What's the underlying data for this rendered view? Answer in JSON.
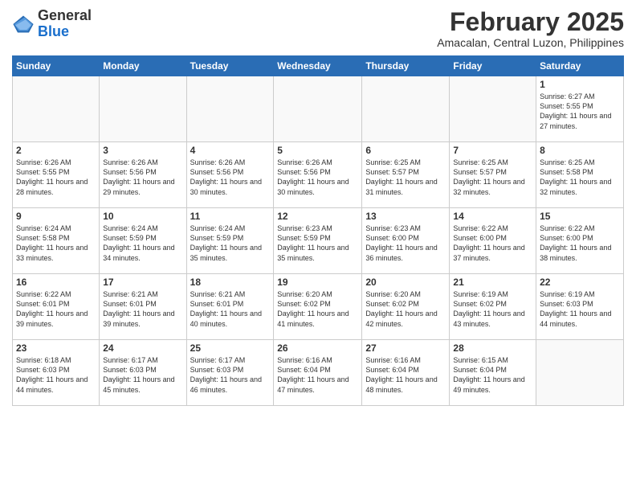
{
  "logo": {
    "general": "General",
    "blue": "Blue"
  },
  "header": {
    "month": "February 2025",
    "location": "Amacalan, Central Luzon, Philippines"
  },
  "weekdays": [
    "Sunday",
    "Monday",
    "Tuesday",
    "Wednesday",
    "Thursday",
    "Friday",
    "Saturday"
  ],
  "weeks": [
    [
      {
        "day": "",
        "info": ""
      },
      {
        "day": "",
        "info": ""
      },
      {
        "day": "",
        "info": ""
      },
      {
        "day": "",
        "info": ""
      },
      {
        "day": "",
        "info": ""
      },
      {
        "day": "",
        "info": ""
      },
      {
        "day": "1",
        "info": "Sunrise: 6:27 AM\nSunset: 5:55 PM\nDaylight: 11 hours and 27 minutes."
      }
    ],
    [
      {
        "day": "2",
        "info": "Sunrise: 6:26 AM\nSunset: 5:55 PM\nDaylight: 11 hours and 28 minutes."
      },
      {
        "day": "3",
        "info": "Sunrise: 6:26 AM\nSunset: 5:56 PM\nDaylight: 11 hours and 29 minutes."
      },
      {
        "day": "4",
        "info": "Sunrise: 6:26 AM\nSunset: 5:56 PM\nDaylight: 11 hours and 30 minutes."
      },
      {
        "day": "5",
        "info": "Sunrise: 6:26 AM\nSunset: 5:56 PM\nDaylight: 11 hours and 30 minutes."
      },
      {
        "day": "6",
        "info": "Sunrise: 6:25 AM\nSunset: 5:57 PM\nDaylight: 11 hours and 31 minutes."
      },
      {
        "day": "7",
        "info": "Sunrise: 6:25 AM\nSunset: 5:57 PM\nDaylight: 11 hours and 32 minutes."
      },
      {
        "day": "8",
        "info": "Sunrise: 6:25 AM\nSunset: 5:58 PM\nDaylight: 11 hours and 32 minutes."
      }
    ],
    [
      {
        "day": "9",
        "info": "Sunrise: 6:24 AM\nSunset: 5:58 PM\nDaylight: 11 hours and 33 minutes."
      },
      {
        "day": "10",
        "info": "Sunrise: 6:24 AM\nSunset: 5:59 PM\nDaylight: 11 hours and 34 minutes."
      },
      {
        "day": "11",
        "info": "Sunrise: 6:24 AM\nSunset: 5:59 PM\nDaylight: 11 hours and 35 minutes."
      },
      {
        "day": "12",
        "info": "Sunrise: 6:23 AM\nSunset: 5:59 PM\nDaylight: 11 hours and 35 minutes."
      },
      {
        "day": "13",
        "info": "Sunrise: 6:23 AM\nSunset: 6:00 PM\nDaylight: 11 hours and 36 minutes."
      },
      {
        "day": "14",
        "info": "Sunrise: 6:22 AM\nSunset: 6:00 PM\nDaylight: 11 hours and 37 minutes."
      },
      {
        "day": "15",
        "info": "Sunrise: 6:22 AM\nSunset: 6:00 PM\nDaylight: 11 hours and 38 minutes."
      }
    ],
    [
      {
        "day": "16",
        "info": "Sunrise: 6:22 AM\nSunset: 6:01 PM\nDaylight: 11 hours and 39 minutes."
      },
      {
        "day": "17",
        "info": "Sunrise: 6:21 AM\nSunset: 6:01 PM\nDaylight: 11 hours and 39 minutes."
      },
      {
        "day": "18",
        "info": "Sunrise: 6:21 AM\nSunset: 6:01 PM\nDaylight: 11 hours and 40 minutes."
      },
      {
        "day": "19",
        "info": "Sunrise: 6:20 AM\nSunset: 6:02 PM\nDaylight: 11 hours and 41 minutes."
      },
      {
        "day": "20",
        "info": "Sunrise: 6:20 AM\nSunset: 6:02 PM\nDaylight: 11 hours and 42 minutes."
      },
      {
        "day": "21",
        "info": "Sunrise: 6:19 AM\nSunset: 6:02 PM\nDaylight: 11 hours and 43 minutes."
      },
      {
        "day": "22",
        "info": "Sunrise: 6:19 AM\nSunset: 6:03 PM\nDaylight: 11 hours and 44 minutes."
      }
    ],
    [
      {
        "day": "23",
        "info": "Sunrise: 6:18 AM\nSunset: 6:03 PM\nDaylight: 11 hours and 44 minutes."
      },
      {
        "day": "24",
        "info": "Sunrise: 6:17 AM\nSunset: 6:03 PM\nDaylight: 11 hours and 45 minutes."
      },
      {
        "day": "25",
        "info": "Sunrise: 6:17 AM\nSunset: 6:03 PM\nDaylight: 11 hours and 46 minutes."
      },
      {
        "day": "26",
        "info": "Sunrise: 6:16 AM\nSunset: 6:04 PM\nDaylight: 11 hours and 47 minutes."
      },
      {
        "day": "27",
        "info": "Sunrise: 6:16 AM\nSunset: 6:04 PM\nDaylight: 11 hours and 48 minutes."
      },
      {
        "day": "28",
        "info": "Sunrise: 6:15 AM\nSunset: 6:04 PM\nDaylight: 11 hours and 49 minutes."
      },
      {
        "day": "",
        "info": ""
      }
    ]
  ]
}
